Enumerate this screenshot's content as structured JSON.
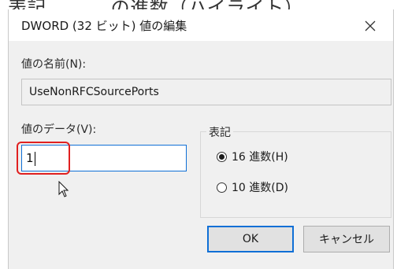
{
  "top_partial_text": "表記 　　　の進数（ハイライト）",
  "dialog": {
    "title": "DWORD (32 ビット) 値の編集",
    "close_symbol": "✕"
  },
  "value_name": {
    "label": "値の名前(N):",
    "value": "UseNonRFCSourcePorts"
  },
  "value_data": {
    "label": "値のデータ(V):",
    "value": "1"
  },
  "base": {
    "title": "表記",
    "options": [
      {
        "label": "16 進数(H)",
        "checked": true
      },
      {
        "label": "10 進数(D)",
        "checked": false
      }
    ]
  },
  "buttons": {
    "ok": "OK",
    "cancel": "キャンセル"
  },
  "colors": {
    "accent": "#0f6fd6",
    "highlight": "#e02020"
  },
  "icons": {
    "close": "close-icon",
    "cursor": "mouse-pointer-icon"
  }
}
